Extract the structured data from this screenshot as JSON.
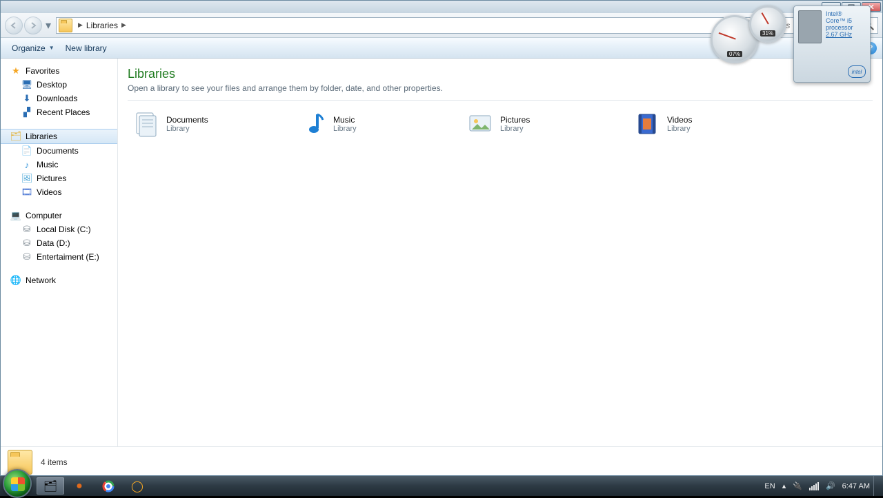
{
  "breadcrumb": {
    "root": "Libraries"
  },
  "search": {
    "placeholder": "Search Libraries"
  },
  "toolbar": {
    "organize": "Organize",
    "newlib": "New library"
  },
  "sidebar": {
    "favorites": {
      "label": "Favorites",
      "items": [
        "Desktop",
        "Downloads",
        "Recent Places"
      ]
    },
    "libraries": {
      "label": "Libraries",
      "items": [
        "Documents",
        "Music",
        "Pictures",
        "Videos"
      ]
    },
    "computer": {
      "label": "Computer",
      "items": [
        "Local Disk (C:)",
        "Data (D:)",
        "Entertaiment (E:)"
      ]
    },
    "network": {
      "label": "Network"
    }
  },
  "content": {
    "title": "Libraries",
    "subtitle": "Open a library to see your files and arrange them by folder, date, and other properties.",
    "type_label": "Library",
    "items": [
      {
        "name": "Documents"
      },
      {
        "name": "Music"
      },
      {
        "name": "Pictures"
      },
      {
        "name": "Videos"
      }
    ]
  },
  "details": {
    "count": "4 items"
  },
  "gadgets": {
    "cpu_pct": "07%",
    "ram_pct": "31%",
    "intel_lines": [
      "Intel®",
      "Core™ i5",
      "processor",
      "2.67 GHz"
    ],
    "intel_logo": "intel"
  },
  "tray": {
    "lang": "EN",
    "time": "6:47 AM"
  }
}
